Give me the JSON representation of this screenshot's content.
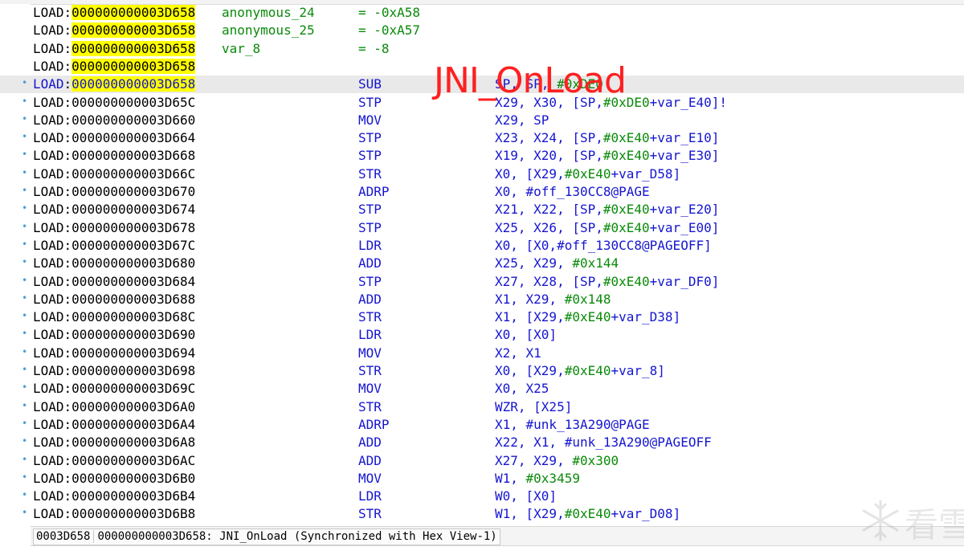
{
  "overlay_label": "JNI_OnLoad",
  "colors": {
    "address_highlight": "#ffff00",
    "mnemonic": "#1515d0",
    "name": "#0a8a0a",
    "overlay": "#ff2020",
    "line_marker": "#4aa0d8"
  },
  "listing": [
    {
      "seg": "LOAD",
      "addr": "000000000003D658",
      "hl": true,
      "name": "anonymous_24",
      "eq": "= ",
      "val": "-0xA58"
    },
    {
      "seg": "LOAD",
      "addr": "000000000003D658",
      "hl": true,
      "name": "anonymous_25",
      "eq": "= ",
      "val": "-0xA57"
    },
    {
      "seg": "LOAD",
      "addr": "000000000003D658",
      "hl": true,
      "name": "var_8",
      "eq": "= ",
      "val": "-8"
    },
    {
      "seg": "LOAD",
      "addr": "000000000003D658",
      "hl": true
    },
    {
      "seg": "LOAD",
      "addr": "000000000003D658",
      "hl": true,
      "current": true,
      "dot": true,
      "mn": "SUB",
      "ops": [
        {
          "t": "SP, SP, "
        },
        {
          "t": "#0xDE0",
          "n": true
        }
      ]
    },
    {
      "seg": "LOAD",
      "addr": "000000000003D65C",
      "dot": true,
      "mn": "STP",
      "ops": [
        {
          "t": "X29, X30, [SP,"
        },
        {
          "t": "#0xDE0",
          "n": true
        },
        {
          "t": "+var_E40]!"
        }
      ]
    },
    {
      "seg": "LOAD",
      "addr": "000000000003D660",
      "dot": true,
      "mn": "MOV",
      "ops": [
        {
          "t": "X29, SP"
        }
      ]
    },
    {
      "seg": "LOAD",
      "addr": "000000000003D664",
      "dot": true,
      "mn": "STP",
      "ops": [
        {
          "t": "X23, X24, [SP,"
        },
        {
          "t": "#0xE40",
          "n": true
        },
        {
          "t": "+var_E10]"
        }
      ]
    },
    {
      "seg": "LOAD",
      "addr": "000000000003D668",
      "dot": true,
      "mn": "STP",
      "ops": [
        {
          "t": "X19, X20, [SP,"
        },
        {
          "t": "#0xE40",
          "n": true
        },
        {
          "t": "+var_E30]"
        }
      ]
    },
    {
      "seg": "LOAD",
      "addr": "000000000003D66C",
      "dot": true,
      "mn": "STR",
      "ops": [
        {
          "t": "X0, [X29,"
        },
        {
          "t": "#0xE40",
          "n": true
        },
        {
          "t": "+var_D58]"
        }
      ]
    },
    {
      "seg": "LOAD",
      "addr": "000000000003D670",
      "dot": true,
      "mn": "ADRP",
      "ops": [
        {
          "t": "X0, #off_130CC8@PAGE"
        }
      ]
    },
    {
      "seg": "LOAD",
      "addr": "000000000003D674",
      "dot": true,
      "mn": "STP",
      "ops": [
        {
          "t": "X21, X22, [SP,"
        },
        {
          "t": "#0xE40",
          "n": true
        },
        {
          "t": "+var_E20]"
        }
      ]
    },
    {
      "seg": "LOAD",
      "addr": "000000000003D678",
      "dot": true,
      "mn": "STP",
      "ops": [
        {
          "t": "X25, X26, [SP,"
        },
        {
          "t": "#0xE40",
          "n": true
        },
        {
          "t": "+var_E00]"
        }
      ]
    },
    {
      "seg": "LOAD",
      "addr": "000000000003D67C",
      "dot": true,
      "mn": "LDR",
      "ops": [
        {
          "t": "X0, [X0,#off_130CC8@PAGEOFF]"
        }
      ]
    },
    {
      "seg": "LOAD",
      "addr": "000000000003D680",
      "dot": true,
      "mn": "ADD",
      "ops": [
        {
          "t": "X25, X29, "
        },
        {
          "t": "#0x144",
          "n": true
        }
      ]
    },
    {
      "seg": "LOAD",
      "addr": "000000000003D684",
      "dot": true,
      "mn": "STP",
      "ops": [
        {
          "t": "X27, X28, [SP,"
        },
        {
          "t": "#0xE40",
          "n": true
        },
        {
          "t": "+var_DF0]"
        }
      ]
    },
    {
      "seg": "LOAD",
      "addr": "000000000003D688",
      "dot": true,
      "mn": "ADD",
      "ops": [
        {
          "t": "X1, X29, "
        },
        {
          "t": "#0x148",
          "n": true
        }
      ]
    },
    {
      "seg": "LOAD",
      "addr": "000000000003D68C",
      "dot": true,
      "mn": "STR",
      "ops": [
        {
          "t": "X1, [X29,"
        },
        {
          "t": "#0xE40",
          "n": true
        },
        {
          "t": "+var_D38]"
        }
      ]
    },
    {
      "seg": "LOAD",
      "addr": "000000000003D690",
      "dot": true,
      "mn": "LDR",
      "ops": [
        {
          "t": "X0, [X0]"
        }
      ]
    },
    {
      "seg": "LOAD",
      "addr": "000000000003D694",
      "dot": true,
      "mn": "MOV",
      "ops": [
        {
          "t": "X2, X1"
        }
      ]
    },
    {
      "seg": "LOAD",
      "addr": "000000000003D698",
      "dot": true,
      "mn": "STR",
      "ops": [
        {
          "t": "X0, [X29,"
        },
        {
          "t": "#0xE40",
          "n": true
        },
        {
          "t": "+var_8]"
        }
      ]
    },
    {
      "seg": "LOAD",
      "addr": "000000000003D69C",
      "dot": true,
      "mn": "MOV",
      "ops": [
        {
          "t": "X0, X25"
        }
      ]
    },
    {
      "seg": "LOAD",
      "addr": "000000000003D6A0",
      "dot": true,
      "mn": "STR",
      "ops": [
        {
          "t": "WZR, [X25]"
        }
      ]
    },
    {
      "seg": "LOAD",
      "addr": "000000000003D6A4",
      "dot": true,
      "mn": "ADRP",
      "ops": [
        {
          "t": "X1, #unk_13A290@PAGE"
        }
      ]
    },
    {
      "seg": "LOAD",
      "addr": "000000000003D6A8",
      "dot": true,
      "mn": "ADD",
      "ops": [
        {
          "t": "X22, X1, #unk_13A290@PAGEOFF"
        }
      ]
    },
    {
      "seg": "LOAD",
      "addr": "000000000003D6AC",
      "dot": true,
      "mn": "ADD",
      "ops": [
        {
          "t": "X27, X29, "
        },
        {
          "t": "#0x300",
          "n": true
        }
      ]
    },
    {
      "seg": "LOAD",
      "addr": "000000000003D6B0",
      "dot": true,
      "mn": "MOV",
      "ops": [
        {
          "t": "W1, "
        },
        {
          "t": "#0x3459",
          "n": true
        }
      ]
    },
    {
      "seg": "LOAD",
      "addr": "000000000003D6B4",
      "dot": true,
      "mn": "LDR",
      "ops": [
        {
          "t": "W0, [X0]"
        }
      ]
    },
    {
      "seg": "LOAD",
      "addr": "000000000003D6B8",
      "dot": true,
      "mn": "STR",
      "ops": [
        {
          "t": "W1, [X29,"
        },
        {
          "t": "#0xE40",
          "n": true
        },
        {
          "t": "+var_D08]"
        }
      ]
    }
  ],
  "status": {
    "short_addr": "0003D658",
    "text": "000000000003D658: JNI_OnLoad (Synchronized with Hex View-1)"
  },
  "watermark": {
    "icon": "snowflake-icon",
    "text": "看雪"
  }
}
